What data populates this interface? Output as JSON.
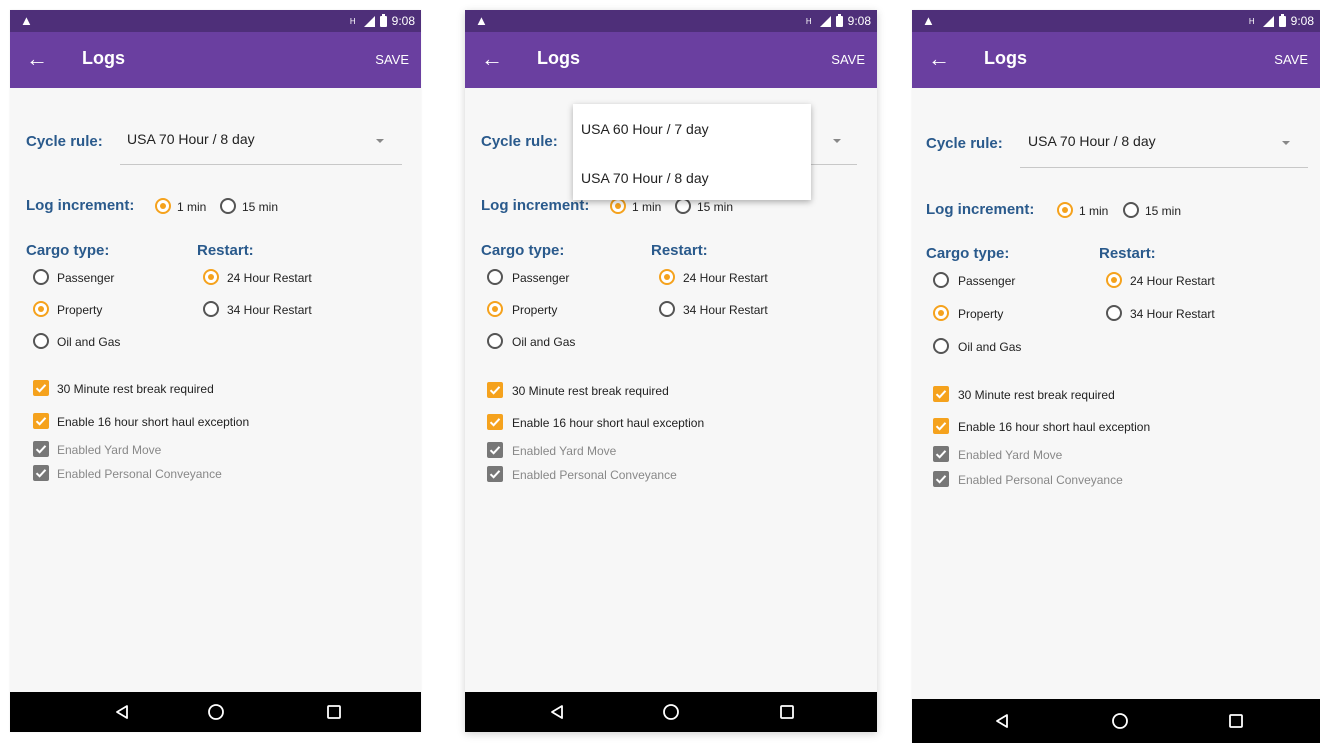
{
  "status": {
    "time": "9:08",
    "warning_icon": "warning-icon",
    "network_label": "H"
  },
  "appbar": {
    "back_icon": "arrow-back-icon",
    "title": "Logs",
    "save_label": "SAVE"
  },
  "cycle": {
    "label": "Cycle rule:",
    "value": "USA 70 Hour / 8 day",
    "options": [
      "USA 60 Hour / 7 day",
      "USA 70 Hour / 8 day"
    ]
  },
  "log_increment": {
    "label": "Log increment:",
    "options": [
      "1 min",
      "15 min"
    ],
    "selected": "1 min"
  },
  "cargo": {
    "label": "Cargo type:",
    "options": [
      "Passenger",
      "Property",
      "Oil and Gas"
    ],
    "selected": "Property"
  },
  "restart": {
    "label": "Restart:",
    "options": [
      "24 Hour Restart",
      "34 Hour Restart"
    ],
    "selected": "24 Hour Restart"
  },
  "checkboxes": [
    {
      "label": "30 Minute rest break required",
      "checked": true,
      "enabled": true
    },
    {
      "label": "Enable 16 hour short haul exception",
      "checked": true,
      "enabled": true
    },
    {
      "label": "Enabled Yard Move",
      "checked": true,
      "enabled": false
    },
    {
      "label": "Enabled Personal Conveyance",
      "checked": true,
      "enabled": false
    }
  ],
  "colors": {
    "status_bar": "#4e2f79",
    "app_bar": "#6a3fa0",
    "label_blue": "#2a5a8c",
    "accent_orange": "#f5a21d"
  }
}
